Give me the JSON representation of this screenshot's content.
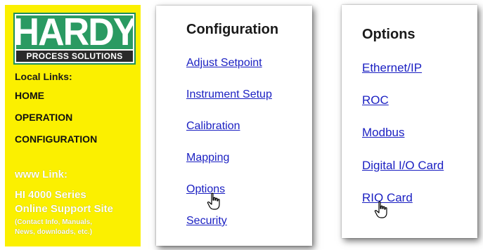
{
  "left_panel": {
    "logo": {
      "brand": "HARDY",
      "subtitle": "PROCESS SOLUTIONS"
    },
    "local_links_heading": "Local Links:",
    "local_links": [
      "HOME",
      "OPERATION",
      "CONFIGURATION"
    ],
    "www_label": "www Link:",
    "support_link": {
      "line1": "HI 4000 Series",
      "line2": "Online Support Site",
      "line3": "(Contact Info, Manuals,",
      "line4": "News, downloads, etc.)"
    },
    "bg_color": "#fbf000"
  },
  "configuration": {
    "title": "Configuration",
    "items": [
      "Adjust Setpoint",
      "Instrument Setup",
      "Calibration",
      "Mapping",
      "Options",
      "Security"
    ]
  },
  "options": {
    "title": "Options",
    "items": [
      "Ethernet/IP",
      "ROC",
      "Modbus",
      "Digital I/O Card",
      "RIO Card"
    ]
  },
  "colors": {
    "link": "#1a1fc2",
    "brand_green": "#2a9a62"
  },
  "icons": [
    "hand-pointer-icon"
  ]
}
